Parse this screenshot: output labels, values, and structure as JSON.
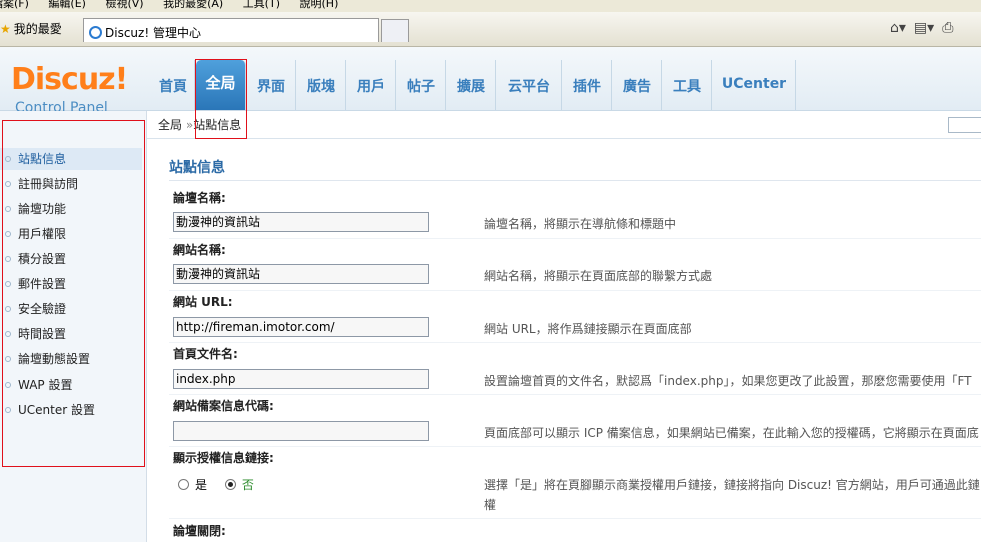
{
  "browser": {
    "menu": [
      "檔案(F)",
      "編輯(E)",
      "檢視(V)",
      "我的最愛(A)",
      "工具(T)",
      "說明(H)"
    ],
    "favorites_label": "我的最愛",
    "tab_title": "Discuz! 管理中心"
  },
  "header": {
    "logo": "Discuz!",
    "logo_sub": "Control Panel",
    "nav": [
      "首頁",
      "全局",
      "界面",
      "版塊",
      "用戶",
      "帖子",
      "擴展",
      "云平台",
      "插件",
      "廣告",
      "工具",
      "UCenter"
    ],
    "active_nav": "全局"
  },
  "breadcrumb": {
    "parent": "全局",
    "separator": "»",
    "current": "站點信息"
  },
  "sidebar": {
    "items": [
      "站點信息",
      "註冊與訪問",
      "論壇功能",
      "用戶權限",
      "積分設置",
      "郵件設置",
      "安全驗證",
      "時間設置",
      "論壇動態設置",
      "WAP 設置",
      "UCenter 設置"
    ]
  },
  "main": {
    "title": "站點信息",
    "fields": [
      {
        "label": "論壇名稱:",
        "value": "動漫神的資訊站",
        "desc": "論壇名稱，將顯示在導航條和標題中"
      },
      {
        "label": "網站名稱:",
        "value": "動漫神的資訊站",
        "desc": "網站名稱，將顯示在頁面底部的聯繫方式處"
      },
      {
        "label": "網站 URL:",
        "value": "http://fireman.imotor.com/",
        "desc": "網站 URL，將作爲鏈接顯示在頁面底部"
      },
      {
        "label": "首頁文件名:",
        "value": "index.php",
        "desc": "設置論壇首頁的文件名，默認爲「index.php」，如果您更改了此設置，那麽您需要使用「FT"
      },
      {
        "label": "網站備案信息代碼:",
        "value": "",
        "desc": "頁面底部可以顯示 ICP 備案信息，如果網站已備案，在此輸入您的授權碼，它將顯示在頁面底"
      }
    ],
    "license_field": {
      "label": "顯示授權信息鏈接:",
      "option_yes": "是",
      "option_no": "否",
      "selected": "否",
      "desc_line1": "選擇「是」將在頁腳顯示商業授權用戶鏈接，鏈接將指向 Discuz! 官方網站，用戶可通過此鏈",
      "desc_line2": "權"
    },
    "next_label": "論壇關閉:"
  }
}
